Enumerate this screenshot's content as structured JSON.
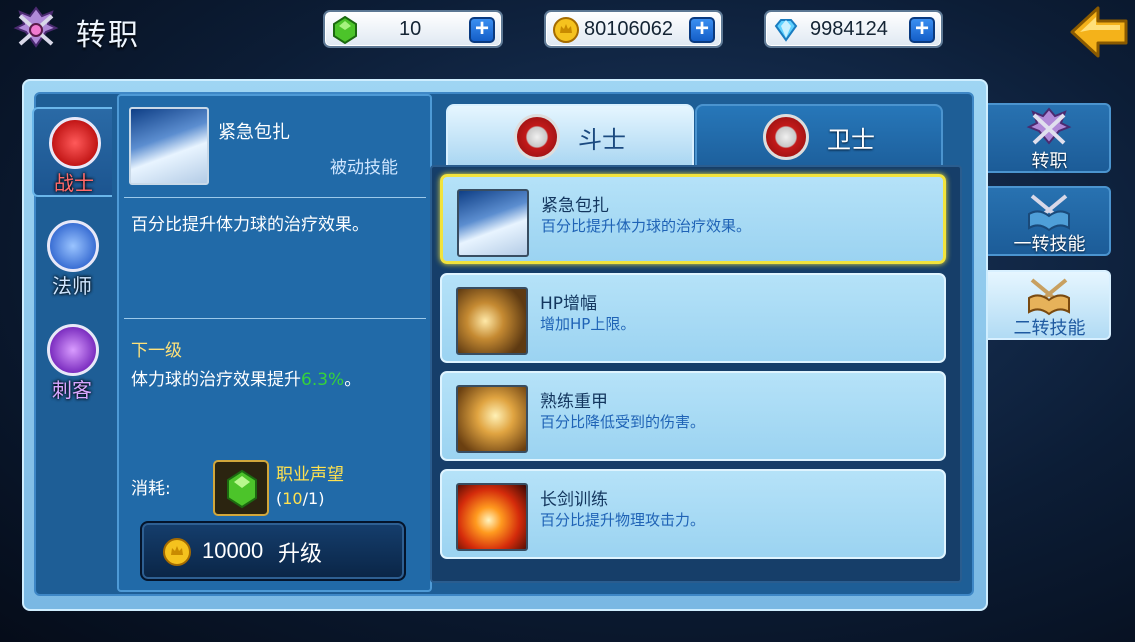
{
  "header": {
    "title": "转职",
    "currencies": [
      {
        "icon": "green-gem-icon",
        "value": "10"
      },
      {
        "icon": "gold-coin-icon",
        "value": "80106062"
      },
      {
        "icon": "diamond-icon",
        "value": "9984124"
      }
    ],
    "plus_label": "+"
  },
  "class_tabs": [
    {
      "label": "战士",
      "active": true
    },
    {
      "label": "法师",
      "active": false
    },
    {
      "label": "刺客",
      "active": false
    }
  ],
  "detail": {
    "skill_name": "紧急包扎",
    "skill_type": "被动技能",
    "description": "百分比提升体力球的治疗效果。",
    "next_level_label": "下一级",
    "next_level_text": "体力球的治疗效果提升",
    "next_level_pct": "6.3%",
    "next_level_suffix": "。",
    "cost_label": "消耗:",
    "cost_item_name": "职业声望",
    "cost_have": "10",
    "cost_need": "1",
    "upgrade_cost": "10000",
    "upgrade_label": "升级"
  },
  "subclass_tabs": [
    {
      "label": "斗士",
      "active": true
    },
    {
      "label": "卫士",
      "active": false
    }
  ],
  "skills": [
    {
      "name": "紧急包扎",
      "desc": "百分比提升体力球的治疗效果。",
      "selected": true
    },
    {
      "name": "HP增幅",
      "desc": "增加HP上限。",
      "selected": false
    },
    {
      "name": "熟练重甲",
      "desc": "百分比降低受到的伤害。",
      "selected": false
    },
    {
      "name": "长剑训练",
      "desc": "百分比提升物理攻击力。",
      "selected": false
    }
  ],
  "side_tabs": [
    {
      "label": "转职",
      "active": false
    },
    {
      "label": "一转技能",
      "active": false
    },
    {
      "label": "二转技能",
      "active": true
    }
  ],
  "colors": {
    "highlight_yellow": "#f2e33c",
    "pct_green": "#35d23b",
    "cost_yellow": "#ffe14f"
  }
}
